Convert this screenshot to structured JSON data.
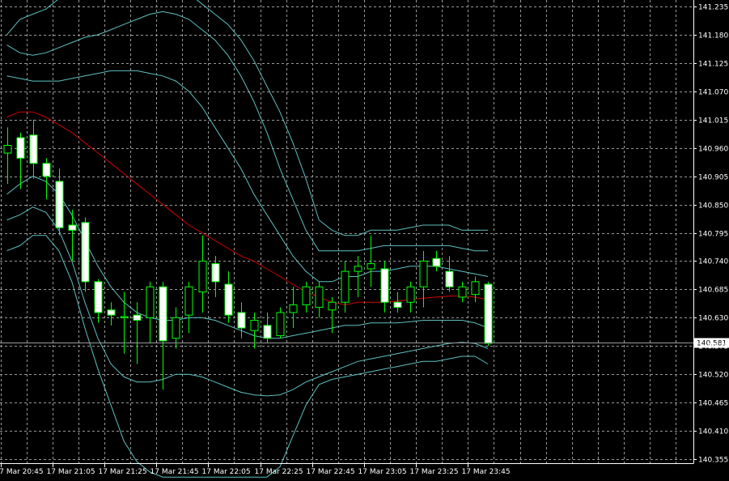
{
  "chart_data": {
    "type": "candlestick",
    "symbol_pair_hint": "",
    "colors": {
      "background": "#000000",
      "grid": "#9a9a9a",
      "axis": "#ffffff",
      "candle_up_body": "#000000",
      "candle_down_body": "#ffffff",
      "wick": "#00ff00",
      "moving_average": "#d00000",
      "bands": "#5fbfbf",
      "current_price_line": "#9a9a9a",
      "current_price_tag_bg": "#ffffff"
    },
    "y_axis": {
      "min": 140.355,
      "max": 141.235,
      "ticks": [
        "141.235",
        "141.180",
        "141.125",
        "141.070",
        "141.015",
        "140.960",
        "140.905",
        "140.850",
        "140.795",
        "140.740",
        "140.685",
        "140.630",
        "140.575",
        "140.520",
        "140.465",
        "140.410",
        "140.355"
      ]
    },
    "x_axis": {
      "ticks": [
        "17 Mar 20:45",
        "17 Mar 21:05",
        "17 Mar 21:25",
        "17 Mar 21:45",
        "17 Mar 22:05",
        "17 Mar 22:25",
        "17 Mar 22:45",
        "17 Mar 23:05",
        "17 Mar 23:25",
        "17 Mar 23:45"
      ]
    },
    "current_price": "140.581",
    "candles": [
      {
        "open": 140.95,
        "high": 141.0,
        "low": 140.89,
        "close": 140.965
      },
      {
        "open": 140.98,
        "high": 140.99,
        "low": 140.88,
        "close": 140.94
      },
      {
        "open": 140.985,
        "high": 141.015,
        "low": 140.9,
        "close": 140.93
      },
      {
        "open": 140.93,
        "high": 140.94,
        "low": 140.86,
        "close": 140.905
      },
      {
        "open": 140.895,
        "high": 140.92,
        "low": 140.79,
        "close": 140.805
      },
      {
        "open": 140.81,
        "high": 140.84,
        "low": 140.74,
        "close": 140.8
      },
      {
        "open": 140.815,
        "high": 140.825,
        "low": 140.68,
        "close": 140.7
      },
      {
        "open": 140.7,
        "high": 140.705,
        "low": 140.62,
        "close": 140.64
      },
      {
        "open": 140.645,
        "high": 140.66,
        "low": 140.615,
        "close": 140.635
      },
      {
        "open": 140.63,
        "high": 140.68,
        "low": 140.56,
        "close": 140.632
      },
      {
        "open": 140.635,
        "high": 140.66,
        "low": 140.54,
        "close": 140.625
      },
      {
        "open": 140.63,
        "high": 140.7,
        "low": 140.58,
        "close": 140.69
      },
      {
        "open": 140.69,
        "high": 140.7,
        "low": 140.49,
        "close": 140.585
      },
      {
        "open": 140.59,
        "high": 140.65,
        "low": 140.57,
        "close": 140.63
      },
      {
        "open": 140.635,
        "high": 140.7,
        "low": 140.6,
        "close": 140.69
      },
      {
        "open": 140.68,
        "high": 140.79,
        "low": 140.64,
        "close": 140.74
      },
      {
        "open": 140.735,
        "high": 140.75,
        "low": 140.67,
        "close": 140.7
      },
      {
        "open": 140.695,
        "high": 140.72,
        "low": 140.62,
        "close": 140.635
      },
      {
        "open": 140.64,
        "high": 140.66,
        "low": 140.59,
        "close": 140.61
      },
      {
        "open": 140.605,
        "high": 140.64,
        "low": 140.57,
        "close": 140.625
      },
      {
        "open": 140.615,
        "high": 140.64,
        "low": 140.58,
        "close": 140.59
      },
      {
        "open": 140.595,
        "high": 140.65,
        "low": 140.59,
        "close": 140.64
      },
      {
        "open": 140.64,
        "high": 140.69,
        "low": 140.61,
        "close": 140.655
      },
      {
        "open": 140.655,
        "high": 140.7,
        "low": 140.64,
        "close": 140.69
      },
      {
        "open": 140.65,
        "high": 140.7,
        "low": 140.63,
        "close": 140.69
      },
      {
        "open": 140.645,
        "high": 140.67,
        "low": 140.6,
        "close": 140.66
      },
      {
        "open": 140.66,
        "high": 140.74,
        "low": 140.64,
        "close": 140.72
      },
      {
        "open": 140.72,
        "high": 140.75,
        "low": 140.67,
        "close": 140.73
      },
      {
        "open": 140.725,
        "high": 140.79,
        "low": 140.69,
        "close": 140.735
      },
      {
        "open": 140.725,
        "high": 140.74,
        "low": 140.64,
        "close": 140.66
      },
      {
        "open": 140.66,
        "high": 140.68,
        "low": 140.64,
        "close": 140.65
      },
      {
        "open": 140.66,
        "high": 140.7,
        "low": 140.64,
        "close": 140.69
      },
      {
        "open": 140.69,
        "high": 140.76,
        "low": 140.65,
        "close": 140.74
      },
      {
        "open": 140.745,
        "high": 140.76,
        "low": 140.72,
        "close": 140.73
      },
      {
        "open": 140.72,
        "high": 140.75,
        "low": 140.68,
        "close": 140.69
      },
      {
        "open": 140.67,
        "high": 140.7,
        "low": 140.66,
        "close": 140.69
      },
      {
        "open": 140.675,
        "high": 140.71,
        "low": 140.66,
        "close": 140.7
      },
      {
        "open": 140.695,
        "high": 140.7,
        "low": 140.575,
        "close": 140.58
      }
    ],
    "moving_average": [
      141.02,
      141.03,
      141.03,
      141.02,
      141.005,
      140.99,
      140.97,
      140.95,
      140.93,
      140.91,
      140.89,
      140.87,
      140.85,
      140.83,
      140.81,
      140.795,
      140.78,
      140.765,
      140.75,
      140.74,
      140.725,
      140.71,
      140.695,
      140.68,
      140.67,
      140.66,
      140.655,
      140.66,
      140.66,
      140.66,
      140.662,
      140.665,
      140.668,
      140.67,
      140.672,
      140.672,
      140.67,
      140.665
    ],
    "bands": [
      [
        141.18,
        141.21,
        141.22,
        141.23,
        141.25,
        141.26,
        141.27,
        141.28,
        141.285,
        141.29,
        141.29,
        141.29,
        141.28,
        141.27,
        141.26,
        141.24,
        141.22,
        141.2,
        141.17,
        141.13,
        141.08,
        141.03,
        140.97,
        140.9,
        140.82,
        140.8,
        140.79,
        140.79,
        140.8,
        140.8,
        140.8,
        140.805,
        140.81,
        140.81,
        140.81,
        140.8,
        140.8,
        140.8
      ],
      [
        141.16,
        141.145,
        141.14,
        141.145,
        141.155,
        141.165,
        141.175,
        141.18,
        141.19,
        141.2,
        141.21,
        141.22,
        141.225,
        141.22,
        141.21,
        141.19,
        141.17,
        141.14,
        141.1,
        141.05,
        140.99,
        140.92,
        140.86,
        140.8,
        140.76,
        140.76,
        140.76,
        140.76,
        140.765,
        140.77,
        140.77,
        140.77,
        140.77,
        140.77,
        140.77,
        140.765,
        140.76,
        140.76
      ],
      [
        141.1,
        141.095,
        141.09,
        141.09,
        141.09,
        141.095,
        141.1,
        141.105,
        141.11,
        141.11,
        141.11,
        141.105,
        141.1,
        141.09,
        141.07,
        141.04,
        141.0,
        140.96,
        140.92,
        140.87,
        140.83,
        140.79,
        140.75,
        140.72,
        140.7,
        140.7,
        140.71,
        140.71,
        140.72,
        140.72,
        140.725,
        140.73,
        140.73,
        140.73,
        140.725,
        140.72,
        140.715,
        140.71
      ],
      [
        140.87,
        140.89,
        140.905,
        140.895,
        140.87,
        140.83,
        140.78,
        140.73,
        140.69,
        140.66,
        140.64,
        140.63,
        140.625,
        140.625,
        140.63,
        140.63,
        140.625,
        140.615,
        140.605,
        140.595,
        140.59,
        140.59,
        140.595,
        140.6,
        140.605,
        140.61,
        140.615,
        140.615,
        140.62,
        140.62,
        140.62,
        140.622,
        140.625,
        140.625,
        140.625,
        140.625,
        140.62,
        140.61
      ],
      [
        140.82,
        140.83,
        140.845,
        140.835,
        140.8,
        140.74,
        140.66,
        140.59,
        140.54,
        140.515,
        140.505,
        140.505,
        140.51,
        140.52,
        140.52,
        140.515,
        140.505,
        140.495,
        140.485,
        140.48,
        140.478,
        140.48,
        140.49,
        140.505,
        140.515,
        140.525,
        140.535,
        140.545,
        140.55,
        140.555,
        140.56,
        140.565,
        140.57,
        140.575,
        140.58,
        140.582,
        140.58,
        140.57
      ],
      [
        140.76,
        140.77,
        140.79,
        140.79,
        140.76,
        140.7,
        140.61,
        140.53,
        140.46,
        140.39,
        140.35,
        140.33,
        140.32,
        140.32,
        140.32,
        140.32,
        140.32,
        140.32,
        140.32,
        140.32,
        140.32,
        140.34,
        140.4,
        140.46,
        140.5,
        140.51,
        140.515,
        140.52,
        140.525,
        140.53,
        140.535,
        140.54,
        140.545,
        140.545,
        140.55,
        140.555,
        140.555,
        140.54
      ]
    ]
  }
}
